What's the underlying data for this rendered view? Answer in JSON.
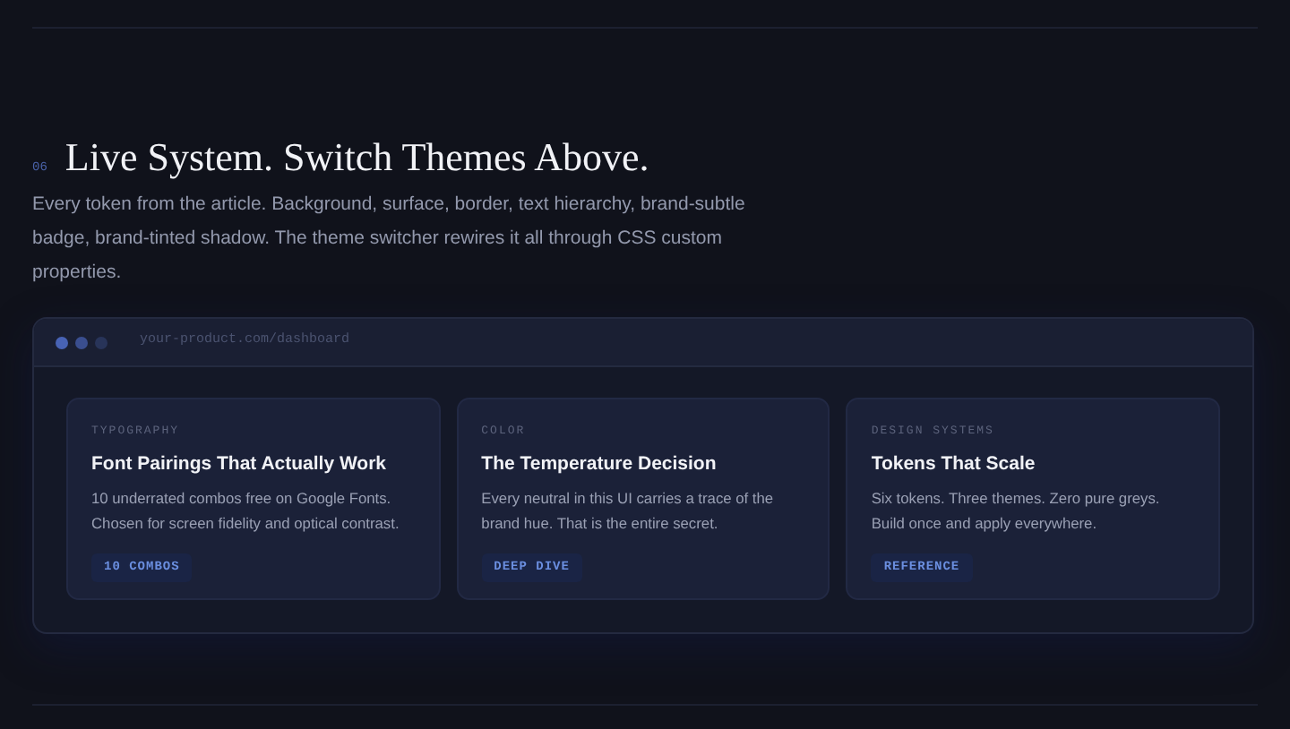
{
  "section": {
    "number": "06",
    "title": "Live System. Switch Themes Above.",
    "description": "Every token from the article. Background, surface, border, text hierarchy, brand-subtle badge, brand-tinted shadow. The theme switcher rewires it all through CSS custom properties."
  },
  "browser": {
    "url": "your-product.com/dashboard"
  },
  "cards": [
    {
      "category": "TYPOGRAPHY",
      "title": "Font Pairings That Actually Work",
      "body": "10 underrated combos free on Google Fonts. Chosen for screen fidelity and optical contrast.",
      "badge": "10 COMBOS"
    },
    {
      "category": "COLOR",
      "title": "The Temperature Decision",
      "body": "Every neutral in this UI carries a trace of the brand hue. That is the entire secret.",
      "badge": "DEEP DIVE"
    },
    {
      "category": "DESIGN SYSTEMS",
      "title": "Tokens That Scale",
      "body": "Six tokens. Three themes. Zero pure greys. Build once and apply everywhere.",
      "badge": "REFERENCE"
    }
  ]
}
